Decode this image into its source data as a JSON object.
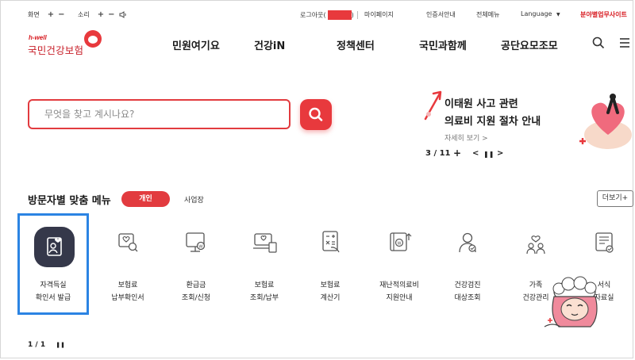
{
  "utility": {
    "screen_label": "화면",
    "sound_label": "소리",
    "plus": "+",
    "minus": "−",
    "logout": "로그아웃(",
    "logout_close": ")",
    "mypage": "마이페이지",
    "cert": "인증서안내",
    "allmenu": "전체메뉴",
    "language": "Language",
    "language_arrow": "▼",
    "sites": "분야별업무사이트"
  },
  "logo": {
    "hwell": "h-well",
    "name": "국민건강보험"
  },
  "gnb": [
    "민원여기요",
    "건강iN",
    "정책센터",
    "국민과함께",
    "공단요모조모"
  ],
  "search": {
    "placeholder": "무엇을 찾고 계시나요?"
  },
  "banner": {
    "title_line1": "이태원 사고 관련",
    "title_line2": "의료비 지원 절차 안내",
    "more": "자세히 보기 >",
    "counter": "3 / 11",
    "plus": "+",
    "prev": "<",
    "pause": "❚❚",
    "next": ">"
  },
  "section": {
    "title": "방문자별 맞춤 메뉴",
    "tab_personal": "개인",
    "tab_business": "사업장",
    "more": "더보기+"
  },
  "services": [
    {
      "line1": "자격득실",
      "line2": "확인서 발급"
    },
    {
      "line1": "보험료",
      "line2": "납부확인서"
    },
    {
      "line1": "환급금",
      "line2": "조회/신청"
    },
    {
      "line1": "보험료",
      "line2": "조회/납부"
    },
    {
      "line1": "보험료",
      "line2": "계산기"
    },
    {
      "line1": "재난적의료비",
      "line2": "지원안내"
    },
    {
      "line1": "건강검진",
      "line2": "대상조회"
    },
    {
      "line1": "가족",
      "line2": "건강관리"
    },
    {
      "line1": "서식",
      "line2": "자료실"
    }
  ],
  "pager": {
    "counter": "1 / 1",
    "pause": "❚❚"
  },
  "colors": {
    "accent": "#e23b3f",
    "brand": "#c8202a",
    "highlight": "#2b84e3",
    "dark_icon": "#35384a"
  }
}
